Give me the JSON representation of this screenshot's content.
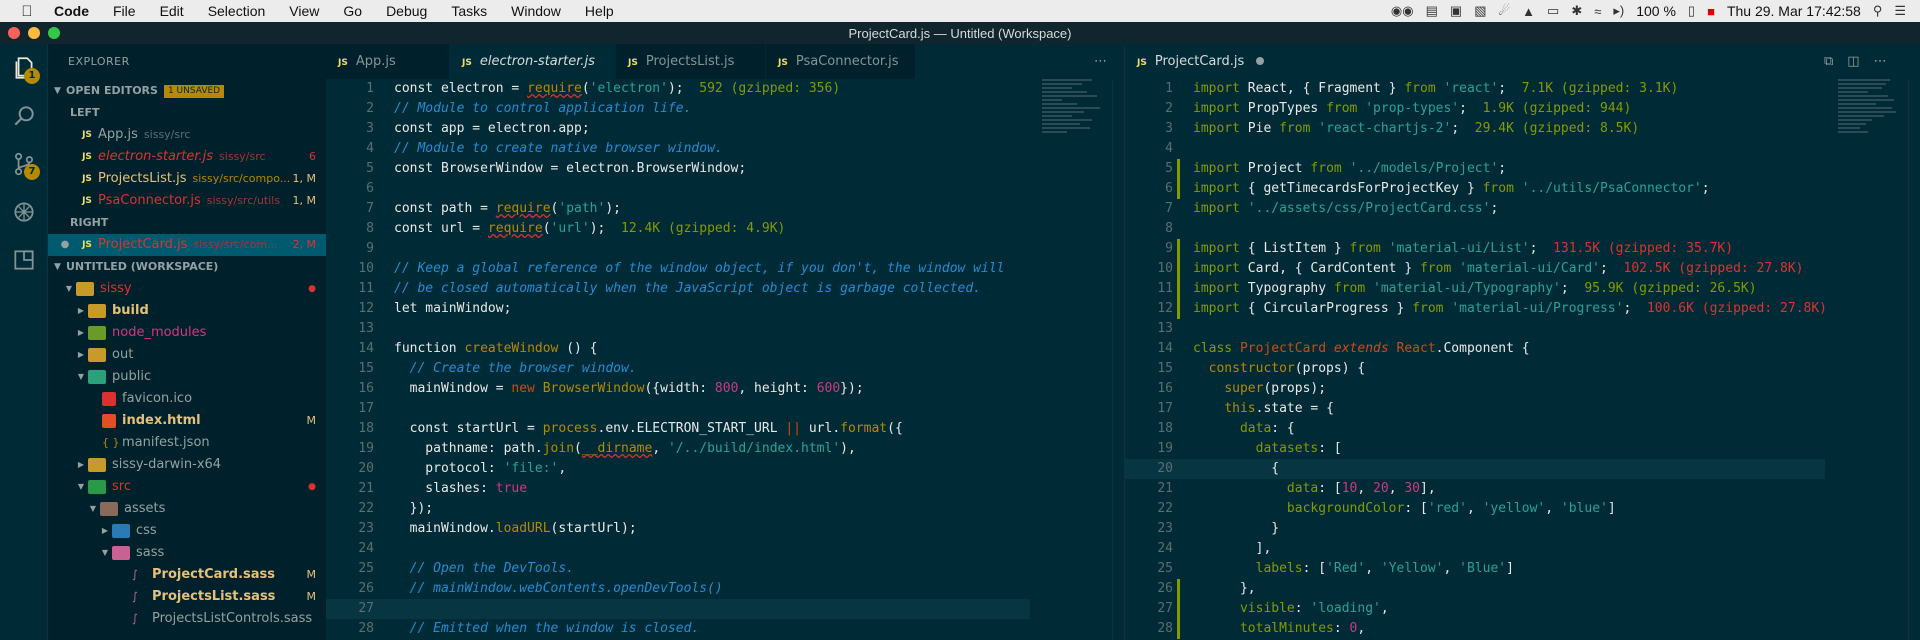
{
  "menubar": {
    "app": "Code",
    "items": [
      "File",
      "Edit",
      "Selection",
      "View",
      "Go",
      "Debug",
      "Tasks",
      "Window",
      "Help"
    ],
    "battery": "100 %",
    "datetime": "Thu 29. Mar  17:42:58"
  },
  "window": {
    "title": "ProjectCard.js — Untitled (Workspace)"
  },
  "activity": {
    "explorer_badge": "1",
    "scm_badge": "7"
  },
  "sidebar": {
    "header": "EXPLORER",
    "open_editors_label": "OPEN EDITORS",
    "unsaved_label": "1 UNSAVED",
    "left_label": "LEFT",
    "right_label": "RIGHT",
    "open_left": [
      {
        "name": "App.js",
        "path": "sissy/src",
        "status": ""
      },
      {
        "name": "electron-starter.js",
        "path": "sissy/src",
        "status": "6"
      },
      {
        "name": "ProjectsList.js",
        "path": "sissy/src/compo...",
        "status": "1, M"
      },
      {
        "name": "PsaConnector.js",
        "path": "sissy/src/utils",
        "status": "1, M"
      }
    ],
    "open_right": [
      {
        "name": "ProjectCard.js",
        "path": "sissy/src/com...",
        "status": "2, M"
      }
    ],
    "workspace_label": "UNTITLED (WORKSPACE)",
    "tree": [
      {
        "name": "sissy",
        "status": ""
      },
      {
        "name": "build",
        "status": ""
      },
      {
        "name": "node_modules",
        "status": ""
      },
      {
        "name": "out",
        "status": ""
      },
      {
        "name": "public",
        "status": ""
      },
      {
        "name": "favicon.ico",
        "status": ""
      },
      {
        "name": "index.html",
        "status": "M"
      },
      {
        "name": "manifest.json",
        "status": ""
      },
      {
        "name": "sissy-darwin-x64",
        "status": ""
      },
      {
        "name": "src",
        "status": ""
      },
      {
        "name": "assets",
        "status": ""
      },
      {
        "name": "css",
        "status": ""
      },
      {
        "name": "sass",
        "status": ""
      },
      {
        "name": "ProjectCard.sass",
        "status": "M"
      },
      {
        "name": "ProjectsList.sass",
        "status": "M"
      },
      {
        "name": "ProjectsListControls.sass",
        "status": ""
      }
    ]
  },
  "left_group": {
    "tabs": [
      "App.js",
      "electron-starter.js",
      "ProjectsList.js",
      "PsaConnector.js"
    ],
    "lines": [
      "1",
      "2",
      "3",
      "4",
      "5",
      "6",
      "7",
      "8",
      "9",
      "10",
      "11",
      "12",
      "13",
      "14",
      "15",
      "16",
      "17",
      "18",
      "19",
      "20",
      "21",
      "22",
      "23",
      "24",
      "25",
      "26",
      "27",
      "28"
    ],
    "code": {
      "l1a": "const electron = ",
      "l1b": "require",
      "l1c": "(",
      "l1d": "'electron'",
      "l1e": ");  ",
      "l1f": "592 (gzipped: 356)",
      "l2": "// Module to control application life.",
      "l3": "const app = electron.app;",
      "l4": "// Module to create native browser window.",
      "l5": "const BrowserWindow = electron.BrowserWindow;",
      "l7a": "const path = ",
      "l7b": "require",
      "l7c": "(",
      "l7d": "'path'",
      "l7e": ");",
      "l8a": "const url = ",
      "l8b": "require",
      "l8c": "(",
      "l8d": "'url'",
      "l8e": ");  ",
      "l8f": "12.4K (gzipped: 4.9K)",
      "l10": "// Keep a global reference of the window object, if you don't, the window will",
      "l11": "// be closed automatically when the JavaScript object is garbage collected.",
      "l12": "let mainWindow;",
      "l14a": "function ",
      "l14b": "createWindow",
      "l14c": " () {",
      "l15": "  // Create the browser window.",
      "l16a": "  mainWindow = ",
      "l16b": "new ",
      "l16c": "BrowserWindow",
      "l16d": "({width: ",
      "l16e": "800",
      "l16f": ", height: ",
      "l16g": "600",
      "l16h": "});",
      "l18a": "  const startUrl = ",
      "l18b": "process",
      "l18c": ".env.ELECTRON_START_URL ",
      "l18d": "||",
      "l18e": " url.",
      "l18f": "format",
      "l18g": "({",
      "l19a": "    pathname: path.",
      "l19b": "join",
      "l19c": "(",
      "l19d": "__dirname",
      "l19e": ", ",
      "l19f": "'/../build/index.html'",
      "l19g": "),",
      "l20a": "    protocol: ",
      "l20b": "'file:'",
      "l20c": ",",
      "l21a": "    slashes: ",
      "l21b": "true",
      "l22": "  });",
      "l23a": "  mainWindow.",
      "l23b": "loadURL",
      "l23c": "(startUrl);",
      "l25": "  // Open the DevTools.",
      "l26": "  // mainWindow.webContents.openDevTools()",
      "l28": "  // Emitted when the window is closed."
    }
  },
  "right_group": {
    "tab": "ProjectCard.js",
    "lines": [
      "1",
      "2",
      "3",
      "4",
      "5",
      "6",
      "7",
      "8",
      "9",
      "10",
      "11",
      "12",
      "13",
      "14",
      "15",
      "16",
      "17",
      "18",
      "19",
      "20",
      "21",
      "22",
      "23",
      "24",
      "25",
      "26",
      "27",
      "28"
    ],
    "code": {
      "r1a": "import ",
      "r1b": "React, { Fragment } ",
      "r1c": "from ",
      "r1d": "'react'",
      "r1e": ";  ",
      "r1f": "7.1K (gzipped: 3.1K)",
      "r2a": "import ",
      "r2b": "PropTypes ",
      "r2c": "from ",
      "r2d": "'prop-types'",
      "r2e": ";  ",
      "r2f": "1.9K (gzipped: 944)",
      "r3a": "import ",
      "r3b": "Pie ",
      "r3c": "from ",
      "r3d": "'react-chartjs-2'",
      "r3e": ";  ",
      "r3f": "29.4K (gzipped: 8.5K)",
      "r5a": "import ",
      "r5b": "Project ",
      "r5c": "from ",
      "r5d": "'../models/Project'",
      "r5e": ";",
      "r6a": "import ",
      "r6b": "{ getTimecardsForProjectKey } ",
      "r6c": "from ",
      "r6d": "'../utils/PsaConnector'",
      "r6e": ";",
      "r7a": "import ",
      "r7b": "'../assets/css/ProjectCard.css'",
      "r7c": ";",
      "r9a": "import ",
      "r9b": "{ ListItem } ",
      "r9c": "from ",
      "r9d": "'material-ui/List'",
      "r9e": ";  ",
      "r9f": "131.5K (gzipped: 35.7K)",
      "r10a": "import ",
      "r10b": "Card, { CardContent } ",
      "r10c": "from ",
      "r10d": "'material-ui/Card'",
      "r10e": ";  ",
      "r10f": "102.5K (gzipped: 27.8K)",
      "r11a": "import ",
      "r11b": "Typography ",
      "r11c": "from ",
      "r11d": "'material-ui/Typography'",
      "r11e": ";  ",
      "r11f": "95.9K (gzipped: 26.5K)",
      "r12a": "import ",
      "r12b": "{ CircularProgress } ",
      "r12c": "from ",
      "r12d": "'material-ui/Progress'",
      "r12e": ";  ",
      "r12f": "100.6K (gzipped: 27.8K)",
      "r14a": "class ",
      "r14b": "ProjectCard ",
      "r14c": "extends ",
      "r14d": "React",
      "r14e": ".Component {",
      "r15a": "  ",
      "r15b": "constructor",
      "r15c": "(props) {",
      "r16a": "    ",
      "r16b": "super",
      "r16c": "(props);",
      "r17a": "    ",
      "r17b": "this",
      "r17c": ".state = {",
      "r18a": "      ",
      "r18b": "data",
      "r18c": ": {",
      "r19a": "        ",
      "r19b": "datasets",
      "r19c": ": [",
      "r20": "          {",
      "r21a": "            ",
      "r21b": "data",
      "r21c": ": [",
      "r21d": "10",
      "r21e": ", ",
      "r21f": "20",
      "r21g": ", ",
      "r21h": "30",
      "r21i": "],",
      "r22a": "            ",
      "r22b": "backgroundColor",
      "r22c": ": [",
      "r22d": "'red'",
      "r22e": ", ",
      "r22f": "'yellow'",
      "r22g": ", ",
      "r22h": "'blue'",
      "r22i": "]",
      "r23": "          }",
      "r24": "        ],",
      "r25a": "        ",
      "r25b": "labels",
      "r25c": ": [",
      "r25d": "'Red'",
      "r25e": ", ",
      "r25f": "'Yellow'",
      "r25g": ", ",
      "r25h": "'Blue'",
      "r25i": "]",
      "r26": "      },",
      "r27a": "      ",
      "r27b": "visible",
      "r27c": ": ",
      "r27d": "'loading'",
      "r27e": ",",
      "r28a": "      ",
      "r28b": "totalMinutes",
      "r28c": ": ",
      "r28d": "0",
      "r28e": ","
    }
  },
  "colors": {
    "accent": "#b58900",
    "editor_bg": "#002b36",
    "sidebar_bg": "#00212b"
  }
}
